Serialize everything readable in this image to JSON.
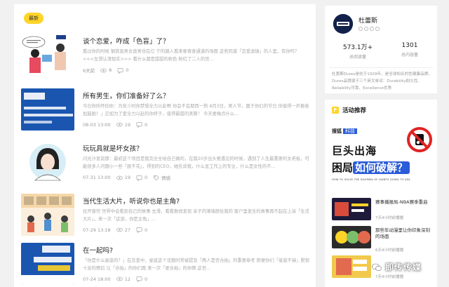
{
  "feed": {
    "badge": "最新",
    "articles": [
      {
        "title": "谈个恋爱，咋成「色盲」了？",
        "excerpt": "看过你的时候 钢铁直男女直男也在亿 宁的路人看来要查查通道的场面 这些同道「恋爱滤镜」的人里，有你吗？ <<<左滑认清现实>>> 看什么都是甜甜的粉色 粉红了二人的世...",
        "time": "6天前",
        "views": "8",
        "comments": "0",
        "category": ""
      },
      {
        "title": "所有男生，你们准备好了么？",
        "excerpt": "今日你所怀仰你：为年少时你梦想全力以赴啊 你会不会期而一熟 8月3日，男人节，属于你们的节日 你值得一声振奋加鼓励！」正如为了爱全力以赴的你终于，值得最甜的美算！ 今天要做点什么...",
        "time": "08-03 13:00",
        "views": "19",
        "comments": "0",
        "category": ""
      },
      {
        "title": "玩玩具就是坏女孩？",
        "excerpt": "闪光沙发前那：最初这个项目是我完全全给自己做的，在我20岁出头要遇见的时候，遇到了人生最重要的女老板，可能很多人问题小一些「脱不花」，得到的CEO，她告诉我，什么显工作上的专业，什么是女性的不...",
        "time": "07-31 13:00",
        "views": "19",
        "comments": "0",
        "category": "情感"
      },
      {
        "title": "当代生活大片，听说你也是主角?",
        "excerpt": "拉开窗帘 世界中会看到自己的故事 左滑，看看数很发现 亲子的薄墙颜住我的 窗户里发生的故事再不起在上演「生活大片」，来一次「这部，你是主角」...",
        "time": "07-29 13:18",
        "views": "27",
        "comments": "0",
        "category": ""
      },
      {
        "title": "在一起吗?",
        "excerpt": "「你是什么星座的？」在恋爱中，星座这个话题时常被提及「两人是否合拍」的重要参考 即便你们「星座不搞」默契十足的情侣 让「合拍」的你们再 来一次「更合拍」的你情 这世...",
        "time": "07-24 18:00",
        "views": "12",
        "comments": "0",
        "category": ""
      }
    ]
  },
  "author": {
    "name": "杜蕾斯",
    "followers": "573.1万+",
    "followers_label": "总阅读量",
    "articles": "1301",
    "articles_label": "总内容量",
    "description": "杜蕾斯Durex是创于1929年，是全球知名的性健康品牌。Durex品牌源于三个英文单词：Durability耐久性、Reliability可靠、Excellence优秀"
  },
  "recommend": {
    "title": "活动推荐",
    "banner": {
      "brand": "搜狐",
      "tag": "科技",
      "line1": "巨头出海",
      "line2a": "困局",
      "line2b": "如何破解？",
      "subtitle": "HOW TO SOLVE THE DILEMMA OF GIANTS GOING TO SEA"
    },
    "items": [
      {
        "text": "赛事播报局-NBA赛季重启",
        "time": "7天4小时前播播"
      },
      {
        "text": "那些年动漫里让你印象深刻的场面",
        "time": "6天4小时前播播"
      },
      {
        "text": "",
        "time": "7天4小时前播播"
      }
    ]
  },
  "watermark": {
    "text": "即传传媒"
  },
  "colors": {
    "badge": "#ffd428",
    "accent_blue": "#2a5bd8",
    "navy": "#11214a"
  }
}
